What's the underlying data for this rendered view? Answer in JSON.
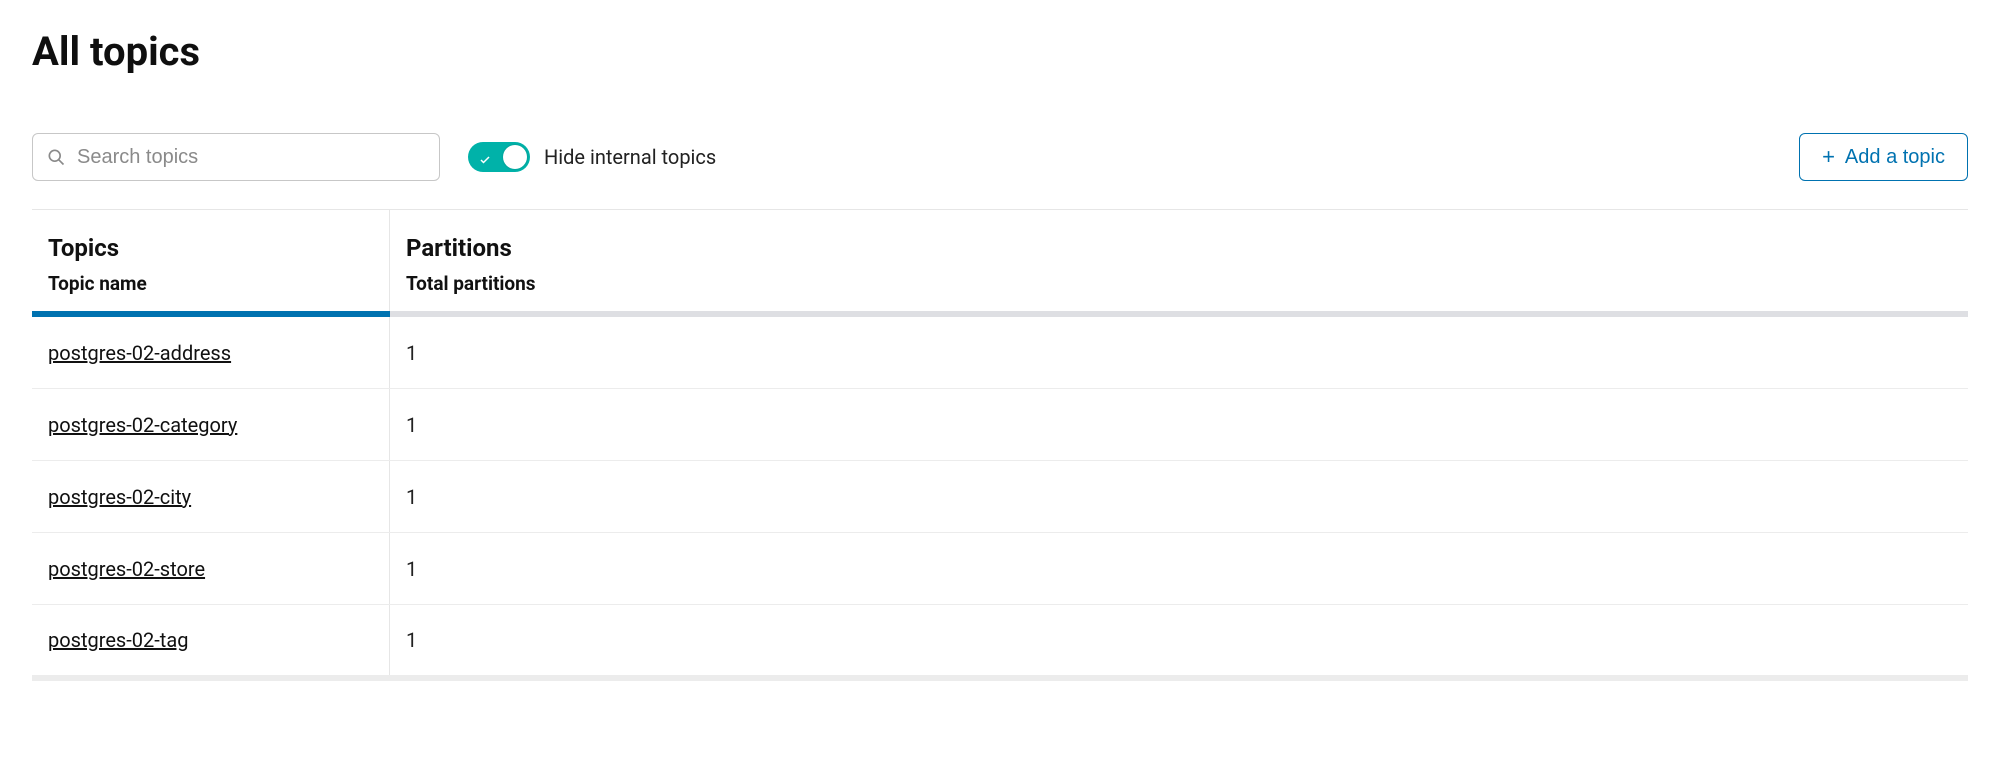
{
  "page": {
    "title": "All topics"
  },
  "search": {
    "placeholder": "Search topics"
  },
  "toggle": {
    "label": "Hide internal topics"
  },
  "actions": {
    "add_button_label": "Add a topic"
  },
  "table": {
    "group_topics": "Topics",
    "group_partitions": "Partitions",
    "col_topic_name": "Topic name",
    "col_total_partitions": "Total partitions",
    "rows": [
      {
        "name": "postgres-02-address",
        "partitions": "1"
      },
      {
        "name": "postgres-02-category",
        "partitions": "1"
      },
      {
        "name": "postgres-02-city",
        "partitions": "1"
      },
      {
        "name": "postgres-02-store",
        "partitions": "1"
      },
      {
        "name": "postgres-02-tag",
        "partitions": "1"
      }
    ]
  }
}
